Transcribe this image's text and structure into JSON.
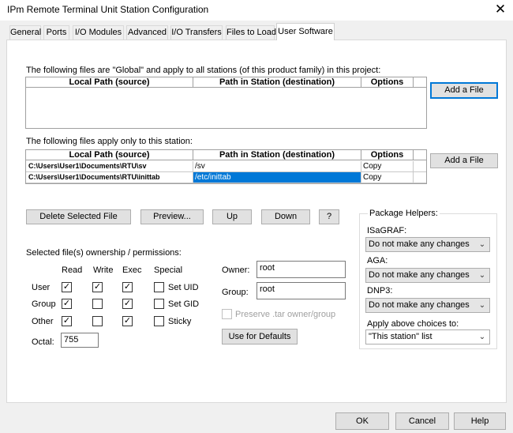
{
  "window": {
    "title": "IPm Remote Terminal Unit Station Configuration",
    "close_glyph": "✕"
  },
  "tabs": [
    {
      "label": "General"
    },
    {
      "label": "Ports"
    },
    {
      "label": "I/O Modules"
    },
    {
      "label": "Advanced"
    },
    {
      "label": "I/O Transfers"
    },
    {
      "label": "Files to Load"
    },
    {
      "label": "User Software"
    }
  ],
  "global_files": {
    "caption": "The following files are \"Global\" and apply to all stations (of this product family) in this project:",
    "columns": [
      "Local Path (source)",
      "Path in Station (destination)",
      "Options"
    ],
    "add_button": "Add a File"
  },
  "station_files": {
    "caption": "The following files apply only to this station:",
    "columns": [
      "Local Path (source)",
      "Path in Station (destination)",
      "Options"
    ],
    "rows": [
      {
        "local": "C:\\Users\\User1\\Documents\\RTU\\sv",
        "dest": "/sv",
        "option": "Copy"
      },
      {
        "local": "C:\\Users\\User1\\Documents\\RTU\\inittab",
        "dest": "/etc/inittab",
        "option": "Copy"
      }
    ],
    "add_button": "Add a File"
  },
  "actions": {
    "delete": "Delete Selected File",
    "preview": "Preview...",
    "up": "Up",
    "down": "Down",
    "help": "?"
  },
  "permissions": {
    "caption": "Selected file(s) ownership / permissions:",
    "headers": {
      "read": "Read",
      "write": "Write",
      "exec": "Exec",
      "special": "Special"
    },
    "rows": [
      {
        "label": "User",
        "read": true,
        "write": true,
        "exec": true,
        "special_label": "Set UID",
        "special": false
      },
      {
        "label": "Group",
        "read": true,
        "write": false,
        "exec": true,
        "special_label": "Set GID",
        "special": false
      },
      {
        "label": "Other",
        "read": true,
        "write": false,
        "exec": true,
        "special_label": "Sticky",
        "special": false
      }
    ],
    "octal_label": "Octal:",
    "octal_value": "755",
    "owner_label": "Owner:",
    "owner_value": "root",
    "group_label": "Group:",
    "group_value": "root",
    "preserve_label": "Preserve .tar owner/group",
    "defaults_button": "Use for Defaults"
  },
  "package_helpers": {
    "caption": "Package Helpers:",
    "isagraf_label": "ISaGRAF:",
    "isagraf_value": "Do not make any changes",
    "aga_label": "AGA:",
    "aga_value": "Do not make any changes",
    "dnp3_label": "DNP3:",
    "dnp3_value": "Do not make any changes",
    "apply_label": "Apply above choices to:",
    "apply_value": "\"This station\" list"
  },
  "footer": {
    "ok": "OK",
    "cancel": "Cancel",
    "help": "Help"
  }
}
